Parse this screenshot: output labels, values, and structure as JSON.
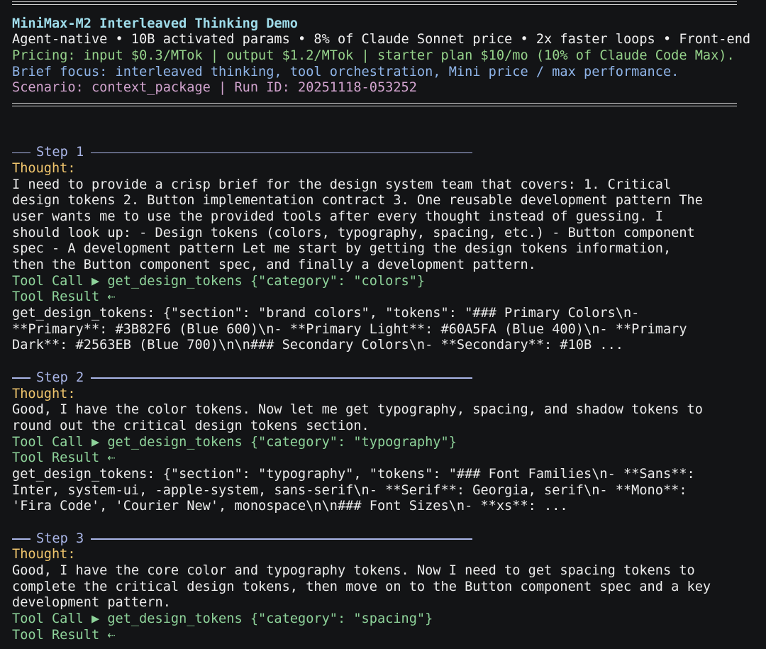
{
  "header": {
    "title": "MiniMax-M2 Interleaved Thinking Demo",
    "tagline": "Agent-native • 10B activated params • 8% of Claude Sonnet price • 2x faster loops • Front-end",
    "pricing": "Pricing: input $0.3/MTok | output $1.2/MTok | starter plan $10/mo (10% of Claude Code Max).",
    "focus": "Brief focus: interleaved thinking, tool orchestration, Mini price / max performance.",
    "scenario": "Scenario: context_package | Run ID: 20251118-053252"
  },
  "steps": [
    {
      "label": "Step 1",
      "thought_label": "Thought:",
      "thought": [
        "I need to provide a crisp brief for the design system team that covers: 1. Critical",
        "design tokens 2. Button implementation contract 3. One reusable development pattern  The",
        "user wants me to use the provided tools after every thought instead of guessing. I",
        "should look up: - Design tokens (colors, typography, spacing, etc.) - Button component",
        "spec - A development pattern  Let me start by getting the design tokens information,",
        "then the Button component spec, and finally a development pattern."
      ],
      "tool_call": "Tool Call ▶ get_design_tokens {\"category\": \"colors\"}",
      "tool_result_label": "Tool Result ⇠",
      "result": [
        "get_design_tokens: {\"section\": \"brand colors\", \"tokens\": \"### Primary Colors\\n-",
        "**Primary**: #3B82F6 (Blue 600)\\n- **Primary Light**: #60A5FA (Blue 400)\\n- **Primary",
        "Dark**: #2563EB (Blue 700)\\n\\n### Secondary Colors\\n- **Secondary**: #10B ..."
      ]
    },
    {
      "label": "Step 2",
      "thought_label": "Thought:",
      "thought": [
        "Good, I have the color tokens. Now let me get typography, spacing, and shadow tokens to",
        "round out the critical design tokens section."
      ],
      "tool_call": "Tool Call ▶ get_design_tokens {\"category\": \"typography\"}",
      "tool_result_label": "Tool Result ⇠",
      "result": [
        "get_design_tokens: {\"section\": \"typography\", \"tokens\": \"### Font Families\\n- **Sans**:",
        "Inter, system-ui, -apple-system, sans-serif\\n- **Serif**: Georgia, serif\\n- **Mono**:",
        "'Fira Code', 'Courier New', monospace\\n\\n### Font Sizes\\n- **xs**: ..."
      ]
    },
    {
      "label": "Step 3",
      "thought_label": "Thought:",
      "thought": [
        "Good, I have the core color and typography tokens. Now I need to get spacing tokens to",
        "complete the critical design tokens, then move on to the Button component spec and a key",
        "development pattern."
      ],
      "tool_call": "Tool Call ▶ get_design_tokens {\"category\": \"spacing\"}",
      "tool_result_label": "Tool Result ⇠",
      "result": []
    }
  ]
}
